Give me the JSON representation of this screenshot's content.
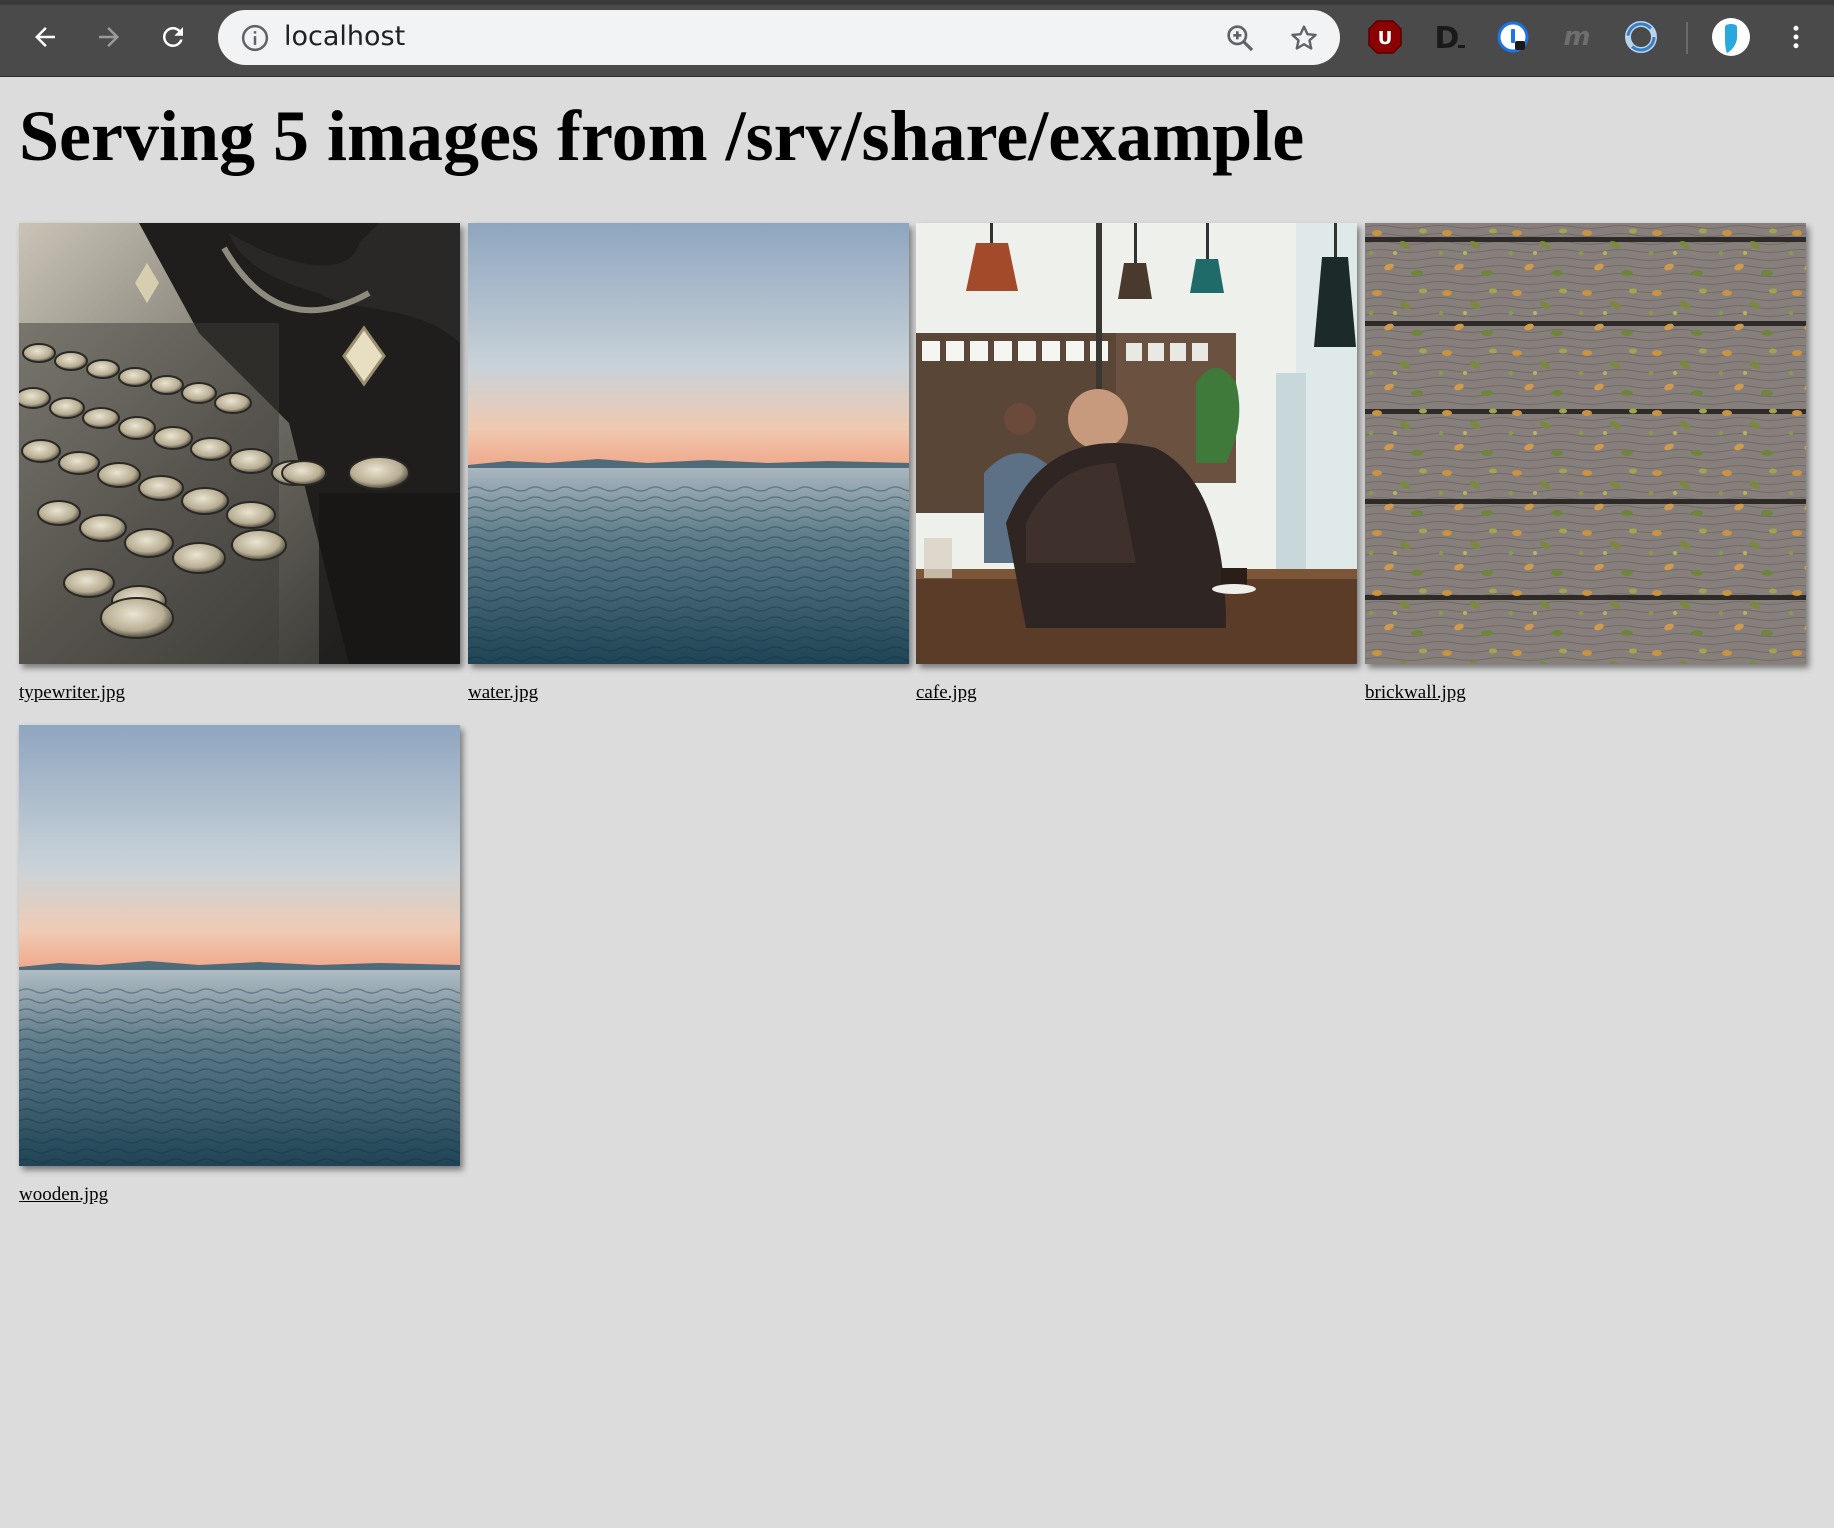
{
  "browser": {
    "url": "localhost",
    "icons": {
      "back": "back-arrow-icon",
      "forward": "forward-arrow-icon",
      "reload": "reload-icon",
      "info": "info-icon",
      "zoom": "zoom-in-icon",
      "bookmark": "star-icon",
      "menu": "kebab-menu-icon"
    },
    "extensions": [
      {
        "name": "ublock-extension-icon",
        "letter": "U"
      },
      {
        "name": "d-extension-icon",
        "letter": "D"
      },
      {
        "name": "password-manager-extension-icon",
        "letter": ""
      },
      {
        "name": "m-extension-icon",
        "letter": "m"
      },
      {
        "name": "sync-extension-icon",
        "letter": ""
      },
      {
        "name": "profile-avatar-icon",
        "letter": ""
      }
    ]
  },
  "page": {
    "title": "Serving 5 images from /srv/share/example",
    "images": [
      {
        "filename": "typewriter.jpg"
      },
      {
        "filename": "water.jpg"
      },
      {
        "filename": "cafe.jpg"
      },
      {
        "filename": "brickwall.jpg"
      },
      {
        "filename": "wooden.jpg"
      }
    ]
  },
  "colors": {
    "page_background": "#dcdcdc",
    "toolbar": "#4a4a4a",
    "omnibox": "#f1f3f4"
  }
}
